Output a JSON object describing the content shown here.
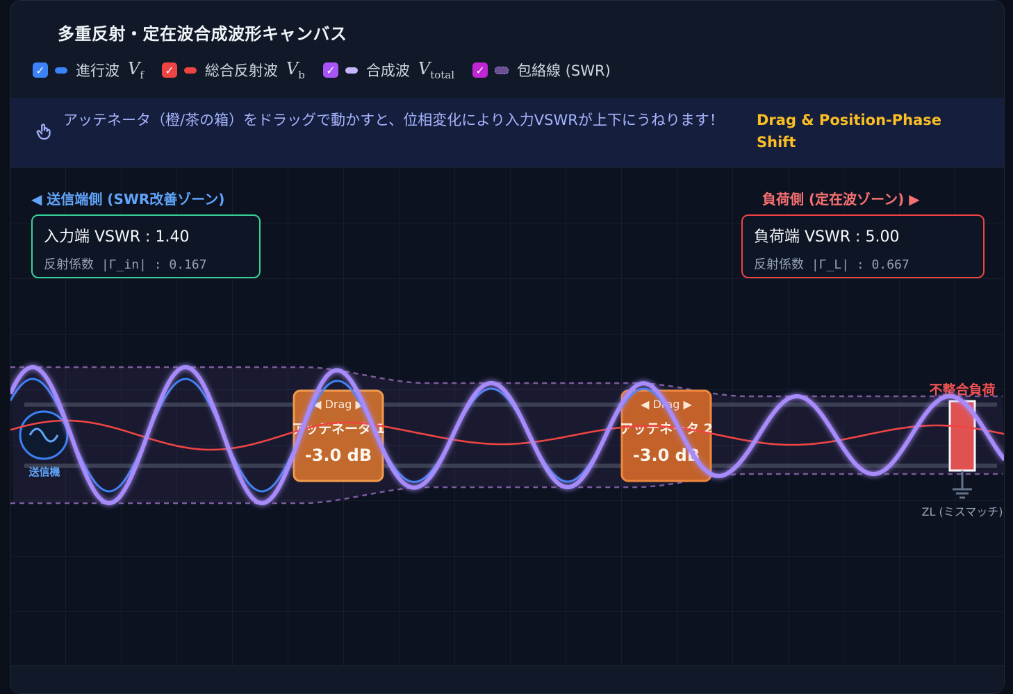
{
  "title": "多重反射・定在波合成波形キャンバス",
  "legend": [
    {
      "label": "進行波",
      "math": "V",
      "sub": "f",
      "color": "#3b82f6",
      "checkbox_color": "#3b82f6",
      "checked": true
    },
    {
      "label": "総合反射波",
      "math": "V",
      "sub": "b",
      "color": "#ef4444",
      "checkbox_color": "#ef4444",
      "checked": true
    },
    {
      "label": "合成波",
      "math": "V",
      "sub": "total",
      "color": "#a78bfa",
      "checkbox_color": "#a855f7",
      "checked": true
    },
    {
      "label": "包絡線 (SWR)",
      "math": "",
      "sub": "",
      "color": "#6b4f8f",
      "checkbox_color": "#c026d3",
      "checked": true
    }
  ],
  "info": {
    "hand_icon": "hand-pointer-icon",
    "text": "アッテネータ（橙/茶の箱）をドラッグで動かすと、位相変化により入力VSWRが上下にうねります！",
    "tag": "Drag & Position-Phase Shift"
  },
  "zones": {
    "left_title": "◀ 送信端側 (SWR改善ゾーン)",
    "right_title": "負荷側 (定在波ゾーン) ▶"
  },
  "input_box": {
    "main_label": "入力端 VSWR",
    "main_value": "1.40",
    "sub_label": "反射係数",
    "sub_symbol": "|Γ_in|",
    "sub_value": "0.167"
  },
  "load_box": {
    "main_label": "負荷端 VSWR",
    "main_value": "5.00",
    "sub_label": "反射係数",
    "sub_symbol": "|Γ_L|",
    "sub_value": "0.667"
  },
  "canvas": {
    "source_label": "送信機",
    "attenuators": [
      {
        "drag_label": "◀ Drag ▶",
        "name": "アッテネータ 1",
        "value": "-3.0 dB"
      },
      {
        "drag_label": "◀ Drag ▶",
        "name": "アッテネータ 2",
        "value": "-3.0 dB"
      }
    ],
    "load_title": "不整合負荷",
    "load_label": "ZL (ミスマッチ)"
  },
  "colors": {
    "forward": "#3b82f6",
    "reflected": "#ef4444",
    "total": "#a78bfa",
    "envelope": "#7c5a9e",
    "attenuator": "#e07b39",
    "load": "#e05252"
  }
}
